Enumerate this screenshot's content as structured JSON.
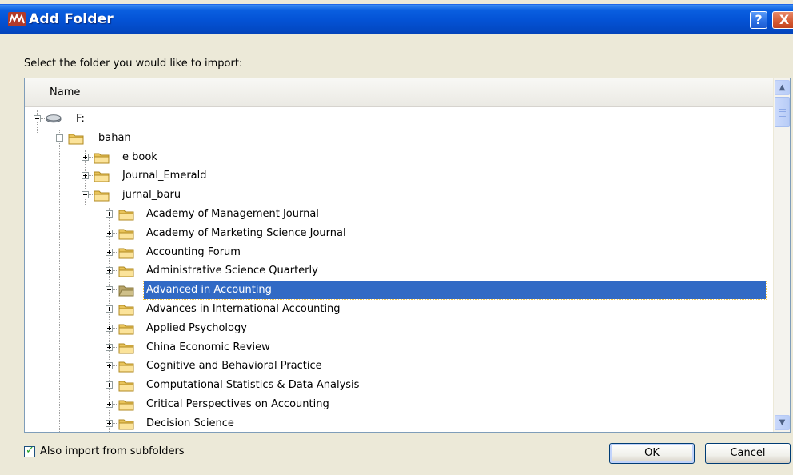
{
  "window": {
    "title": "Add Folder",
    "help_glyph": "?",
    "close_glyph": "X"
  },
  "dialog": {
    "prompt": "Select the folder you would like to import:",
    "column_header": "Name"
  },
  "tree": [
    {
      "label": "F:",
      "depth": 0,
      "icon": "drive-icon",
      "expander": "minus"
    },
    {
      "label": "bahan",
      "depth": 1,
      "icon": "folder-icon",
      "expander": "minus"
    },
    {
      "label": "e book",
      "depth": 2,
      "icon": "folder-icon",
      "expander": "plus"
    },
    {
      "label": "Journal_Emerald",
      "depth": 2,
      "icon": "folder-icon",
      "expander": "plus"
    },
    {
      "label": "jurnal_baru",
      "depth": 2,
      "icon": "folder-icon",
      "expander": "minus"
    },
    {
      "label": "Academy of Management Journal",
      "depth": 3,
      "icon": "folder-icon",
      "expander": "plus"
    },
    {
      "label": "Academy of Marketing Science Journal",
      "depth": 3,
      "icon": "folder-icon",
      "expander": "plus"
    },
    {
      "label": "Accounting Forum",
      "depth": 3,
      "icon": "folder-icon",
      "expander": "plus"
    },
    {
      "label": "Administrative Science Quarterly",
      "depth": 3,
      "icon": "folder-icon",
      "expander": "plus"
    },
    {
      "label": "Advanced in Accounting",
      "depth": 3,
      "icon": "folder-open-icon",
      "expander": "minus",
      "selected": true
    },
    {
      "label": "Advances in International Accounting",
      "depth": 3,
      "icon": "folder-icon",
      "expander": "plus"
    },
    {
      "label": "Applied Psychology",
      "depth": 3,
      "icon": "folder-icon",
      "expander": "plus"
    },
    {
      "label": "China Economic Review",
      "depth": 3,
      "icon": "folder-icon",
      "expander": "plus"
    },
    {
      "label": "Cognitive and Behavioral Practice",
      "depth": 3,
      "icon": "folder-icon",
      "expander": "plus"
    },
    {
      "label": "Computational Statistics & Data Analysis",
      "depth": 3,
      "icon": "folder-icon",
      "expander": "plus"
    },
    {
      "label": "Critical Perspectives on Accounting",
      "depth": 3,
      "icon": "folder-icon",
      "expander": "plus"
    },
    {
      "label": "Decision Science",
      "depth": 3,
      "icon": "folder-icon",
      "expander": "plus"
    }
  ],
  "options": {
    "subfolders_label": "Also import from subfolders",
    "subfolders_checked": true
  },
  "buttons": {
    "ok": "OK",
    "cancel": "Cancel"
  },
  "colors": {
    "title_bar": "#0453d6",
    "selection": "#316ac5",
    "folder": "#f5d76e"
  }
}
